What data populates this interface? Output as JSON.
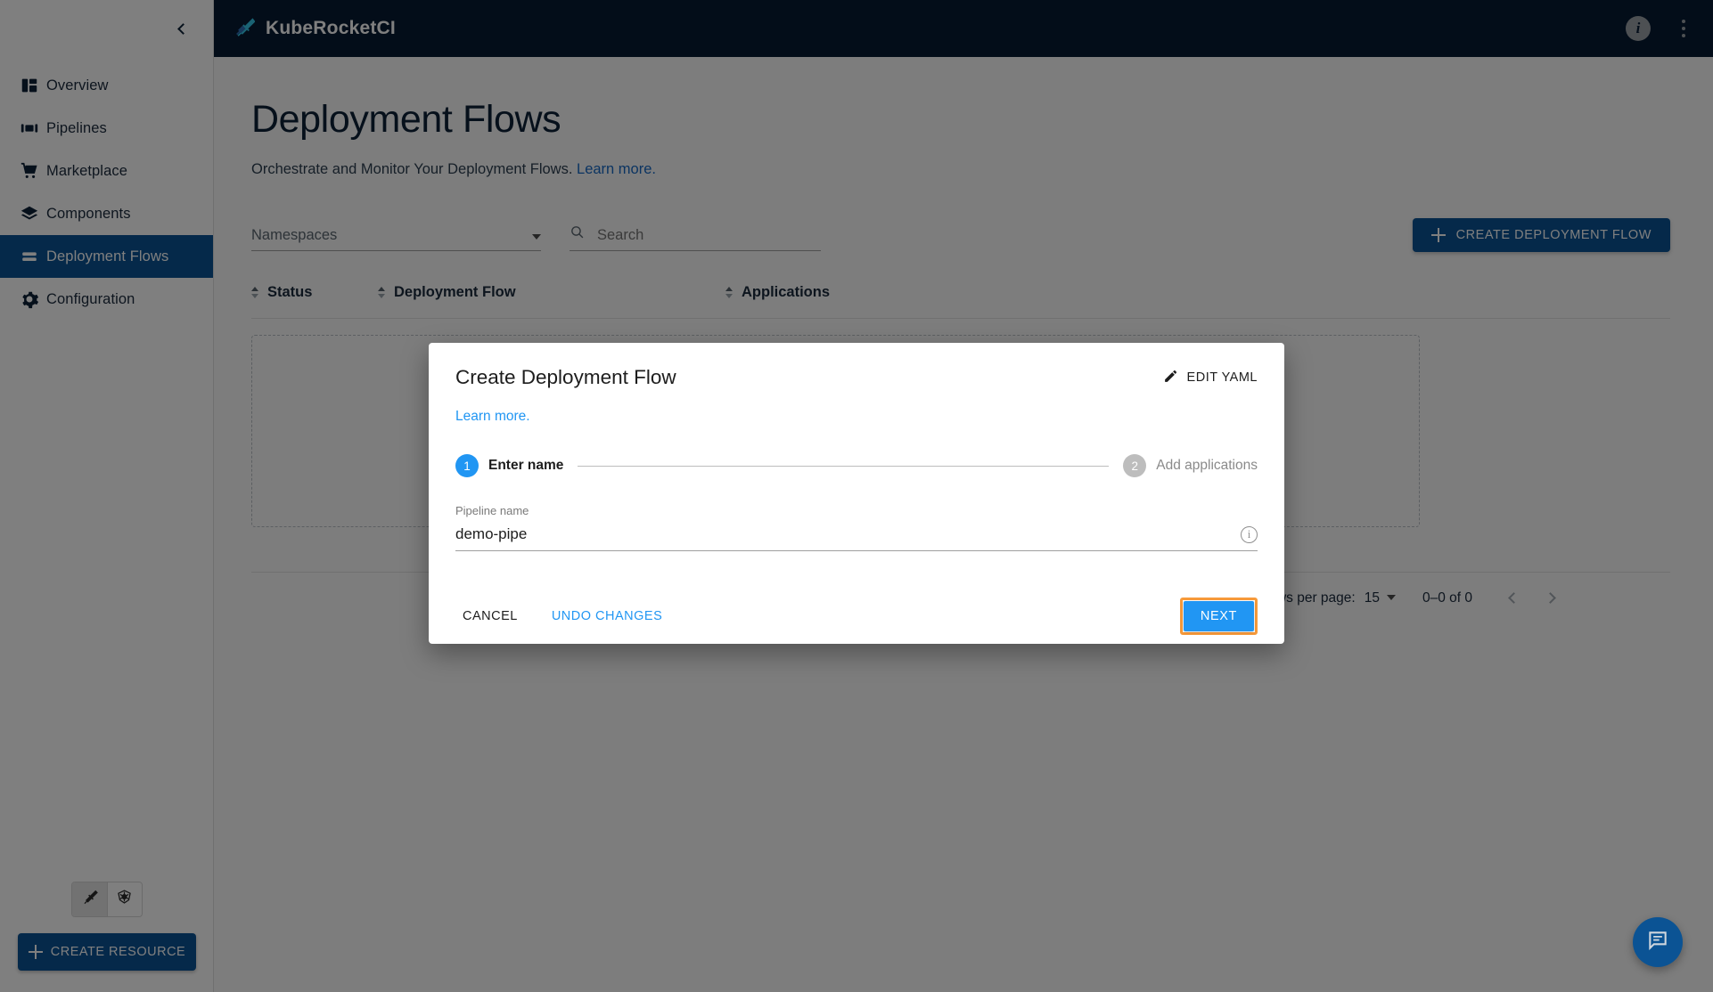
{
  "sidebar": {
    "collapse_icon": "chevron-left-icon",
    "items": [
      {
        "label": "Overview",
        "icon": "dashboard-icon",
        "active": false
      },
      {
        "label": "Pipelines",
        "icon": "pipelines-icon",
        "active": false
      },
      {
        "label": "Marketplace",
        "icon": "cart-icon",
        "active": false
      },
      {
        "label": "Components",
        "icon": "layers-icon",
        "active": false
      },
      {
        "label": "Deployment Flows",
        "icon": "deployment-flow-icon",
        "active": true
      },
      {
        "label": "Configuration",
        "icon": "gear-icon",
        "active": false
      }
    ],
    "toggles": [
      {
        "icon": "krci-sword-icon",
        "selected": true
      },
      {
        "icon": "kubernetes-icon",
        "selected": false
      }
    ],
    "create_resource_label": "CREATE RESOURCE"
  },
  "topbar": {
    "logo_icon": "krci-rocket-icon",
    "brand": "KubeRocketCI",
    "info_icon": "info-icon",
    "menu_icon": "kebab-menu-icon"
  },
  "page": {
    "title": "Deployment Flows",
    "subtitle": "Orchestrate and Monitor Your Deployment Flows.",
    "subtitle_link": "Learn more."
  },
  "toolbar": {
    "namespaces_label": "Namespaces",
    "namespaces_value": "",
    "search_placeholder": "Search",
    "search_value": "",
    "search_icon": "search-icon",
    "create_button_label": "CREATE DEPLOYMENT FLOW",
    "create_button_icon": "plus-icon"
  },
  "table": {
    "columns": [
      "Status",
      "Deployment Flow",
      "Applications"
    ],
    "rows": [],
    "footer": {
      "rows_per_page_label": "Rows per page:",
      "rows_per_page_value": "15",
      "range_label": "0–0 of 0",
      "prev_icon": "chevron-left-icon",
      "next_icon": "chevron-right-icon"
    }
  },
  "chat_fab": {
    "icon": "chat-icon"
  },
  "modal": {
    "title": "Create Deployment Flow",
    "edit_yaml_label": "EDIT YAML",
    "edit_yaml_icon": "pencil-icon",
    "learn_more": "Learn more.",
    "steps": [
      {
        "num": "1",
        "label": "Enter name",
        "state": "active"
      },
      {
        "num": "2",
        "label": "Add applications",
        "state": "idle"
      }
    ],
    "field": {
      "label": "Pipeline name",
      "value": "demo-pipe",
      "placeholder": "",
      "info_icon": "info-icon"
    },
    "cancel_label": "CANCEL",
    "undo_label": "UNDO CHANGES",
    "next_label": "NEXT"
  },
  "colors": {
    "brand_dark": "#071a33",
    "accent_blue": "#0b5394",
    "bright_blue": "#2196f3",
    "highlight_orange": "#f79a3a",
    "link_blue": "#1769c4"
  }
}
